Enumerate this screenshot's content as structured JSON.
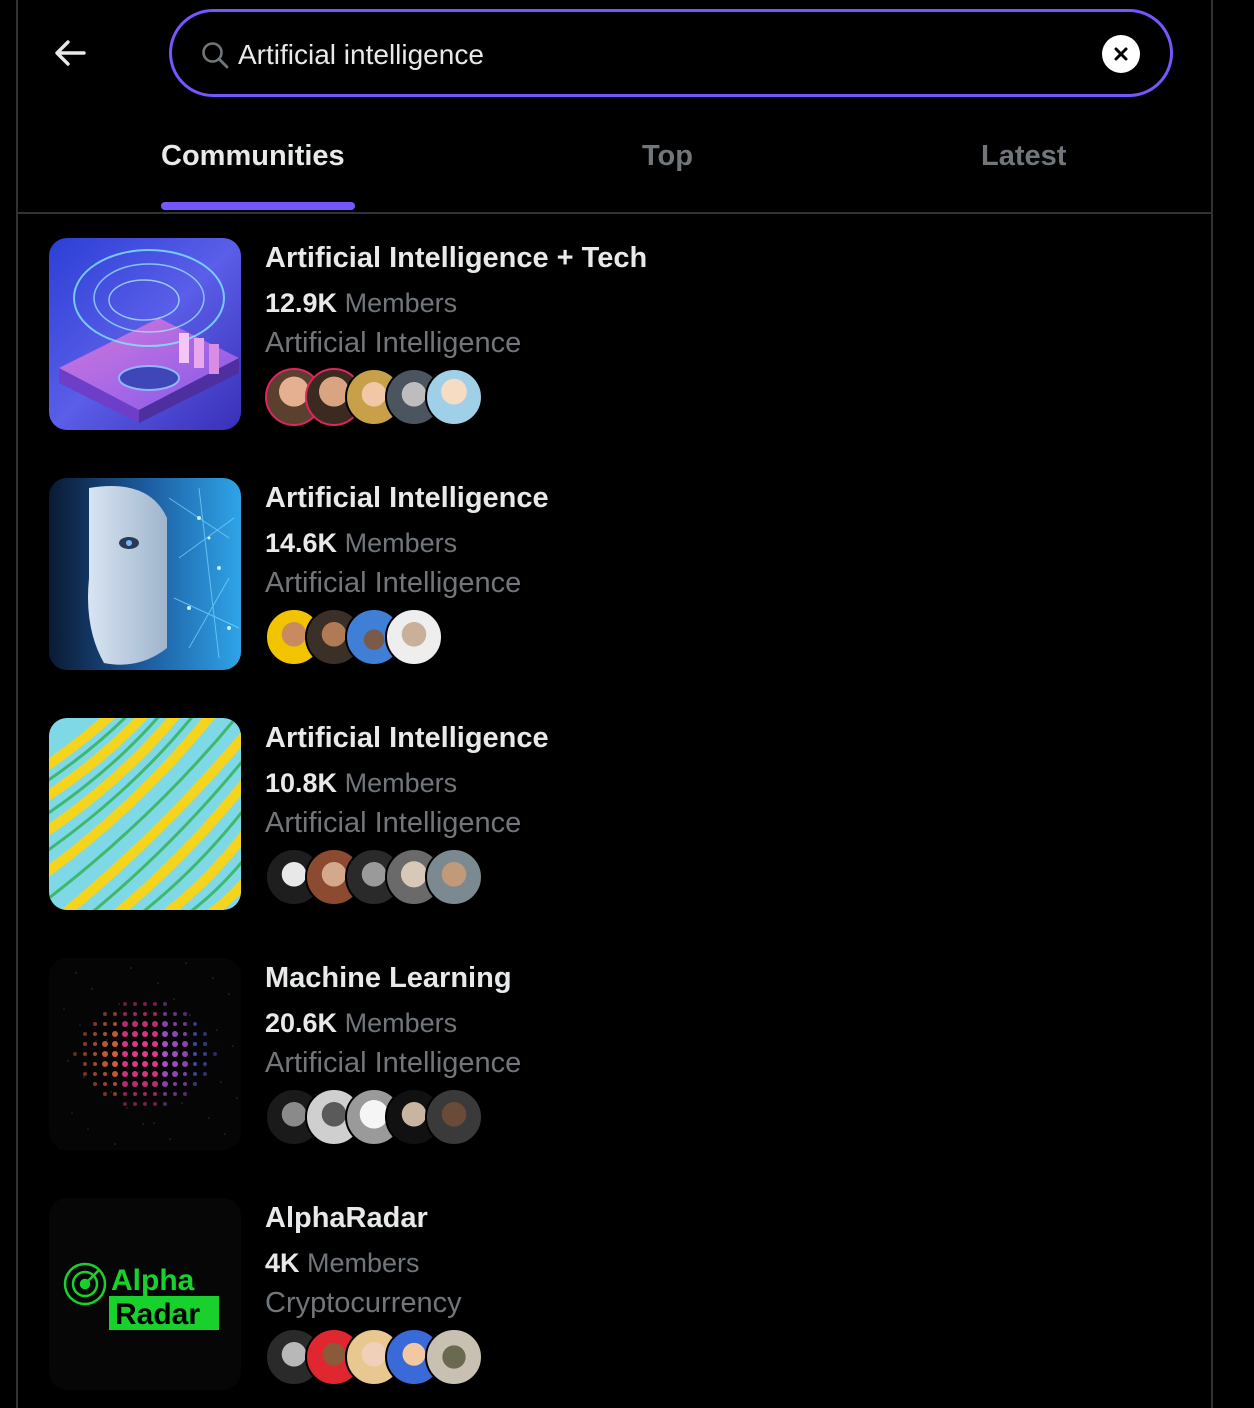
{
  "search": {
    "query": "Artificial intelligence",
    "placeholder": "Search"
  },
  "tabs": [
    {
      "label": "Communities",
      "active": true
    },
    {
      "label": "Top",
      "active": false
    },
    {
      "label": "Latest",
      "active": false
    }
  ],
  "communities": [
    {
      "title": "Artificial Intelligence + Tech",
      "members_count": "12.9K",
      "members_label": "Members",
      "category": "Artificial Intelligence"
    },
    {
      "title": "Artificial Intelligence",
      "members_count": "14.6K",
      "members_label": "Members",
      "category": "Artificial Intelligence"
    },
    {
      "title": "Artificial Intelligence",
      "members_count": "10.8K",
      "members_label": "Members",
      "category": "Artificial Intelligence"
    },
    {
      "title": "Machine Learning",
      "members_count": "20.6K",
      "members_label": "Members",
      "category": "Artificial Intelligence"
    },
    {
      "title": "AlphaRadar",
      "members_count": "4K",
      "members_label": "Members",
      "category": "Cryptocurrency"
    }
  ],
  "logo_text": {
    "line1": "Alpha",
    "line2": "Radar"
  },
  "colors": {
    "accent": "#7856ff",
    "text": "#e7e9ea",
    "muted": "#71767b",
    "border": "#2f3336",
    "alpha_green": "#19d12c"
  }
}
